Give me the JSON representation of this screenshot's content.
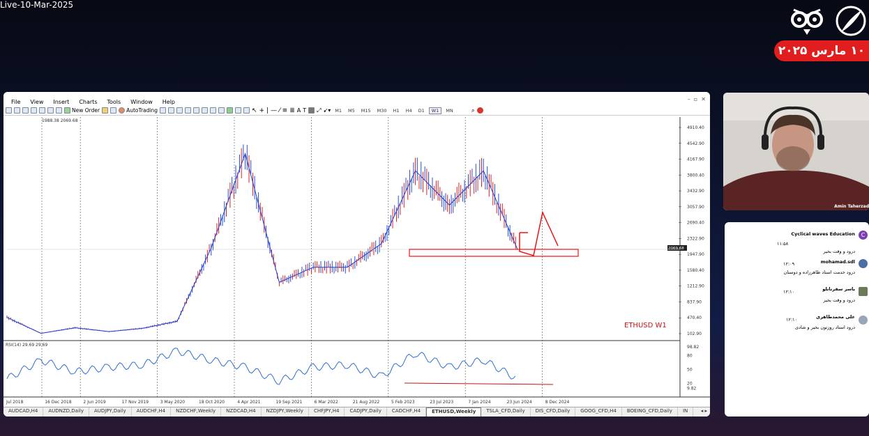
{
  "stream": {
    "title": "Live-10-Mar-2025",
    "date_badge": "۱۰ مارس ۲۰۲۵"
  },
  "mt4": {
    "menu": [
      "File",
      "View",
      "Insert",
      "Charts",
      "Tools",
      "Window",
      "Help"
    ],
    "toolbar": {
      "new_order": "New Order",
      "autotrading": "AutoTrading"
    },
    "timeframes": [
      "M1",
      "M5",
      "M15",
      "M30",
      "H1",
      "H4",
      "D1",
      "W1",
      "MN"
    ],
    "active_timeframe": "W1",
    "chart": {
      "header": "1988.38 2069.68",
      "symbol_label": "ETHUSD W1",
      "price_ticks": [
        "4910.40",
        "4542.90",
        "4167.90",
        "3800.40",
        "3432.90",
        "3057.90",
        "2690.40",
        "2322.90",
        "1947.90",
        "1580.40",
        "1212.90",
        "837.90",
        "470.40",
        "102.90"
      ],
      "current_price": "2069.68",
      "date_ticks": [
        "Jul 2018",
        "16 Dec 2018",
        "2 Jun 2019",
        "17 Nov 2019",
        "3 May 2020",
        "18 Oct 2020",
        "4 Apr 2021",
        "19 Sep 2021",
        "6 Mar 2022",
        "21 Aug 2022",
        "5 Feb 2023",
        "23 Jul 2023",
        "7 Jan 2024",
        "23 Jun 2024",
        "8 Dec 2024"
      ],
      "rsi_header": "RSI(14) 29.69 29.69",
      "rsi_ticks": [
        "98.82",
        "80",
        "50",
        "20",
        "9.82"
      ],
      "chart_data": {
        "type": "line",
        "series": [
          {
            "name": "ETHUSD W1",
            "values": [
              480,
              110,
              240,
              150,
              230,
              390,
              2100,
              4300,
              1300,
              1650,
              1650,
              2200,
              3900,
              3100,
              3900,
              2070
            ]
          }
        ],
        "rsi": [
          30,
          70,
          45,
          55,
          60,
          90,
          70,
          55,
          25,
          55,
          60,
          35,
          85,
          55,
          70,
          30
        ],
        "ylim": [
          102.9,
          4910.4
        ]
      }
    },
    "tabs": [
      "AUDCAD,H4",
      "AUDNZD,Daily",
      "AUDJPY,Daily",
      "AUDCHF,H4",
      "NZDCHF,Weekly",
      "NZDCAD,H4",
      "NZDJPY,Weekly",
      "CHFJPY,H4",
      "CADJPY,Daily",
      "CADCHF,H4",
      "ETHUSD,Weekly",
      "TSLA_CFD,Daily",
      "DIS_CFD,Daily",
      "GOOG_CFD,H4",
      "BOEING_CFD,Daily",
      "IN"
    ],
    "active_tab": "ETHUSD,Weekly"
  },
  "video": {
    "presenter": "Amin Taherzad"
  },
  "chat": {
    "messages": [
      {
        "name": "Cyclical waves Education",
        "time": "۱۱:۵۸",
        "text": "درود و وقت بخیر",
        "avatar_letter": "C",
        "avatar_color": "#7b3fb5"
      },
      {
        "name": "mohamad.sdl",
        "time": "۱۲:۰۹",
        "text": "درود خدمت استاد طاهرزاده و دوستان",
        "avatar_color": "#4a6fa5"
      },
      {
        "name": "یاسر سفرنانلو",
        "time": "۱۲:۱۰",
        "text": "درود و وقت بخیر",
        "avatar_color": "#6b7b5a"
      },
      {
        "name": "علی محمدطاهری",
        "time": "۱۲:۱۰",
        "text": "درود استاد روزتون بخیر و شادی",
        "avatar_color": "#9aa6b8"
      }
    ]
  }
}
